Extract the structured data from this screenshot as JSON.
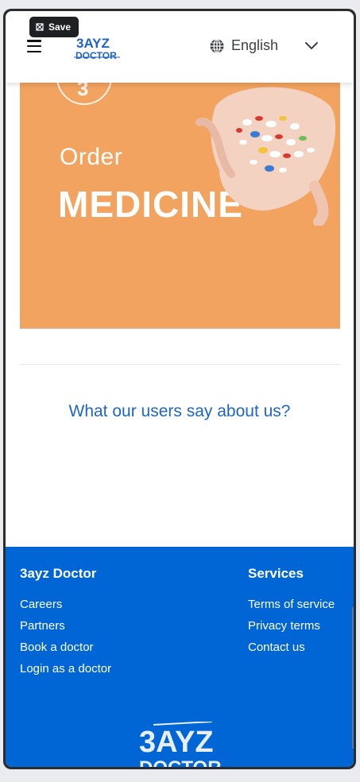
{
  "header": {
    "save_label": "Save",
    "logo_line1": "3AYZ",
    "logo_line2": "DOCTOR",
    "language": "English",
    "icons": {
      "menu": "hamburger-menu-icon",
      "globe": "globe-icon",
      "chevron": "chevron-down-icon",
      "save": "save-icon"
    }
  },
  "banner": {
    "step": "3",
    "line1": "Order",
    "line2": "MEDICINE",
    "color": "#f2a35f"
  },
  "testimonials": {
    "title": "What our users say about us?"
  },
  "footer": {
    "col1": {
      "title": "3ayz Doctor",
      "links": [
        "Careers",
        "Partners",
        "Book a doctor",
        "Login as a doctor"
      ]
    },
    "col2": {
      "title": "Services",
      "links": [
        "Terms of service",
        "Privacy terms",
        "Contact us"
      ]
    },
    "logo_line1": "3AYZ",
    "logo_line2": "DOCTOR",
    "color": "#0066d6"
  }
}
